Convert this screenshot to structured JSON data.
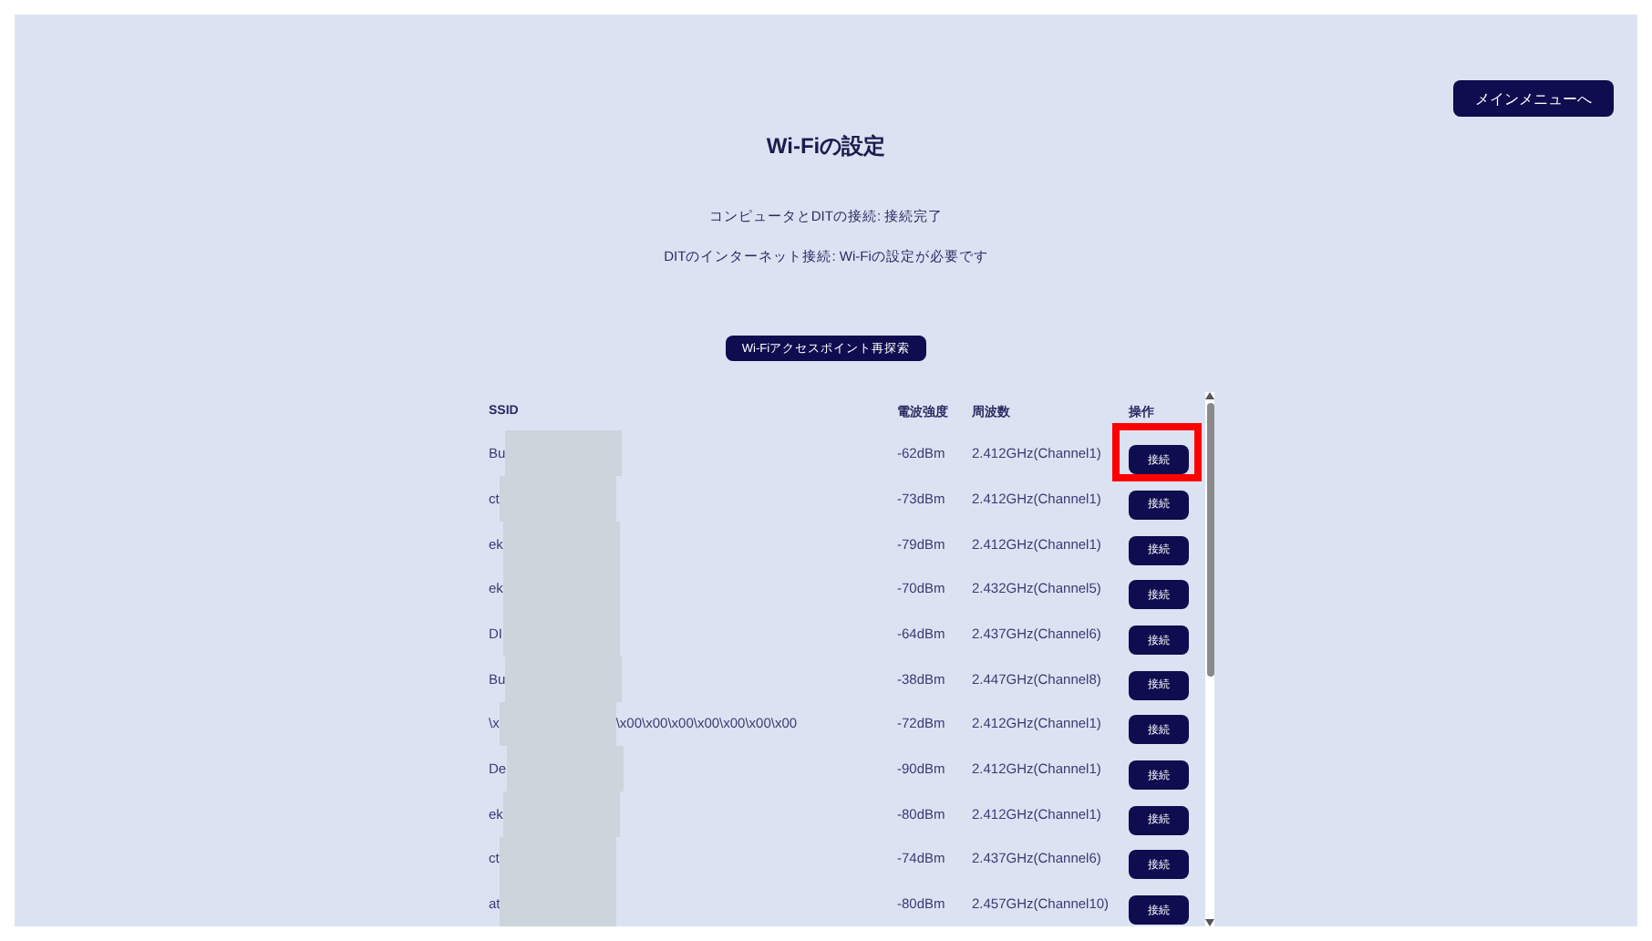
{
  "menu_button": "メインメニューへ",
  "title": "Wi-Fiの設定",
  "status_lines": [
    "コンピュータとDITの接続: 接続完了",
    "DITのインターネット接続: Wi-Fiの設定が必要です"
  ],
  "rescan_button": "Wi-Fiアクセスポイント再探索",
  "table": {
    "columns": [
      "SSID",
      "電波強度",
      "周波数",
      "操作"
    ],
    "rows": [
      {
        "ssid": "Bu",
        "signal": "-62dBm",
        "frequency": "2.412GHz(Channel1)",
        "action": "接続",
        "highlighted": true
      },
      {
        "ssid": "ct",
        "signal": "-73dBm",
        "frequency": "2.412GHz(Channel1)",
        "action": "接続",
        "highlighted": false
      },
      {
        "ssid": "ek",
        "signal": "-79dBm",
        "frequency": "2.412GHz(Channel1)",
        "action": "接続",
        "highlighted": false
      },
      {
        "ssid": "ek",
        "signal": "-70dBm",
        "frequency": "2.432GHz(Channel5)",
        "action": "接続",
        "highlighted": false
      },
      {
        "ssid": "DI",
        "signal": "-64dBm",
        "frequency": "2.437GHz(Channel6)",
        "action": "接続",
        "highlighted": false
      },
      {
        "ssid": "Bu",
        "signal": "-38dBm",
        "frequency": "2.447GHz(Channel8)",
        "action": "接続",
        "highlighted": false
      },
      {
        "ssid": "\\x",
        "ssid_tail": "\\x00\\x00\\x00\\x00\\x00\\x00\\x00",
        "signal": "-72dBm",
        "frequency": "2.412GHz(Channel1)",
        "action": "接続",
        "highlighted": false
      },
      {
        "ssid": "De",
        "signal": "-90dBm",
        "frequency": "2.412GHz(Channel1)",
        "action": "接続",
        "highlighted": false
      },
      {
        "ssid": "ek",
        "signal": "-80dBm",
        "frequency": "2.412GHz(Channel1)",
        "action": "接続",
        "highlighted": false
      },
      {
        "ssid": "ct",
        "signal": "-74dBm",
        "frequency": "2.437GHz(Channel6)",
        "action": "接続",
        "highlighted": false
      },
      {
        "ssid": "at",
        "signal": "-80dBm",
        "frequency": "2.457GHz(Channel10)",
        "action": "接続",
        "highlighted": false
      }
    ]
  }
}
